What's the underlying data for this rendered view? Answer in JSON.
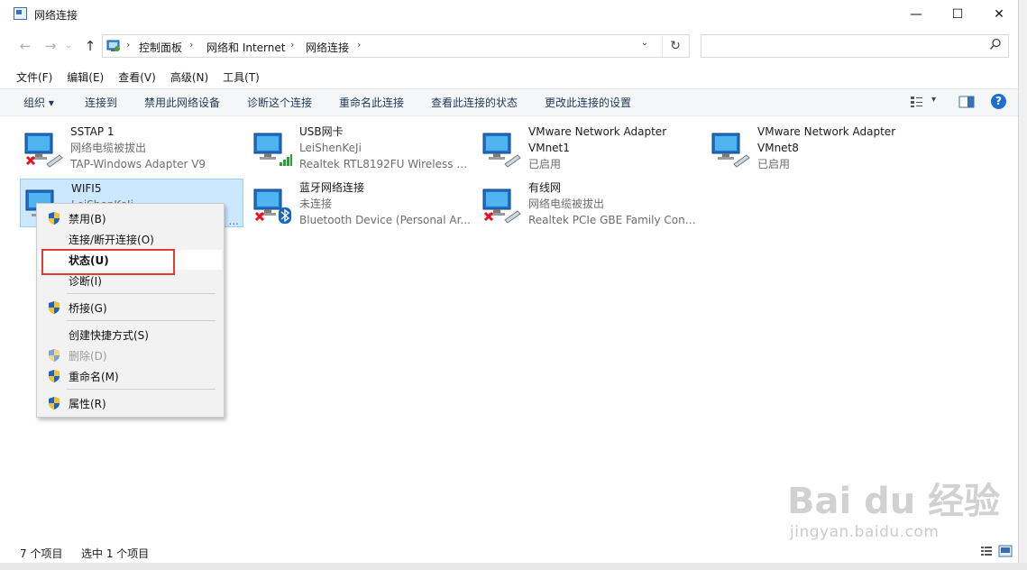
{
  "window": {
    "title": "网络连接",
    "controls": {
      "minimize": "—",
      "maximize": "☐",
      "close": "✕"
    }
  },
  "address_bar": {
    "breadcrumbs": [
      "控制面板",
      "网络和 Internet",
      "网络连接"
    ],
    "separator": "›",
    "dropdown": "⌄",
    "refresh": "↻",
    "search_placeholder": ""
  },
  "nav": {
    "back": "←",
    "forward": "→",
    "recent": "⌄",
    "up": "↑"
  },
  "menu": [
    "文件(F)",
    "编辑(E)",
    "查看(V)",
    "高级(N)",
    "工具(T)"
  ],
  "toolbar": {
    "organize": "组织 ▾",
    "items": [
      "连接到",
      "禁用此网络设备",
      "诊断这个连接",
      "重命名此连接",
      "查看此连接的状态",
      "更改此连接的设置"
    ],
    "view_arrow": "▾",
    "help": "?"
  },
  "adapters": [
    {
      "name": "SSTAP 1",
      "status": "网络电缆被拔出",
      "device": "TAP-Windows Adapter V9",
      "badge": "x"
    },
    {
      "name": "USB网卡",
      "status": "LeiShenKeJi",
      "device": "Realtek RTL8192FU Wireless L...",
      "badge": "signal"
    },
    {
      "name": "VMware Network Adapter",
      "status": "VMnet1",
      "device": "已启用",
      "badge": "cable"
    },
    {
      "name": "VMware Network Adapter",
      "status": "VMnet8",
      "device": "已启用",
      "badge": "cable"
    },
    {
      "name": "WIFI5",
      "status": "LeiShenKeJi",
      "device": "...",
      "badge": "signal",
      "selected": true
    },
    {
      "name": "蓝牙网络连接",
      "status": "未连接",
      "device": "Bluetooth Device (Personal Ar...",
      "badge": "bluetooth"
    },
    {
      "name": "有线网",
      "status": "网络电缆被拔出",
      "device": "Realtek PCIe GBE Family Contr...",
      "badge": "x"
    }
  ],
  "context_menu": [
    {
      "label": "禁用(B)",
      "shield": true
    },
    {
      "label": "连接/断开连接(O)",
      "shield": false
    },
    {
      "label": "状态(U)",
      "shield": false,
      "bold": true,
      "highlight": true
    },
    {
      "label": "诊断(I)",
      "shield": false
    },
    {
      "label": "桥接(G)",
      "shield": true
    },
    {
      "label": "创建快捷方式(S)",
      "shield": false
    },
    {
      "label": "删除(D)",
      "shield": true,
      "disabled": true
    },
    {
      "label": "重命名(M)",
      "shield": true
    },
    {
      "label": "属性(R)",
      "shield": true
    }
  ],
  "status_bar": {
    "count": "7 个项目",
    "selection": "选中 1 个项目"
  },
  "watermark": {
    "brand": "Bai du 经验",
    "url": "jingyan.baidu.com"
  },
  "colors": {
    "accent": "#1e395b",
    "selection": "#cce8ff",
    "highlight_box": "#e53935",
    "error_x": "#e81123"
  }
}
